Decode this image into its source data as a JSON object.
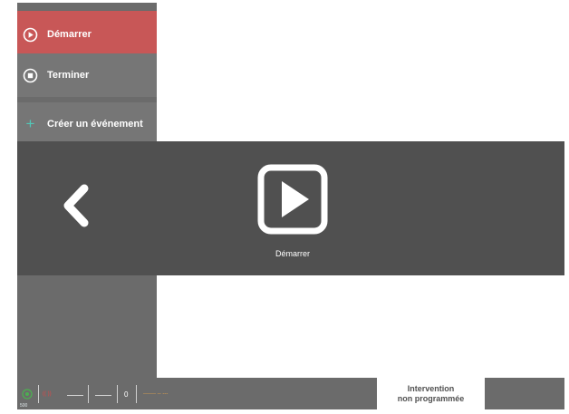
{
  "sidebar": {
    "start_label": "Démarrer",
    "end_label": "Terminer",
    "create_label": "Créer un événement",
    "create_icon_glyph": "+"
  },
  "overlay": {
    "action_label": "Démarrer"
  },
  "footer": {
    "gps_value": "500",
    "red_indicator": "(( ))",
    "counter_value": "0",
    "orange_indicator": "------- -- ---",
    "intervention_line1": "Intervention",
    "intervention_line2": "non programmée"
  },
  "colors": {
    "start_bg": "#c85757",
    "sidebar_bg": "#6b6b6b",
    "overlay_bg": "#505050",
    "accent_teal": "#52c7b8",
    "status_green": "#4caf50",
    "status_red": "#e04545",
    "status_orange": "#e7a54a"
  },
  "icons": {
    "start": "play-circle-icon",
    "end": "stop-circle-icon",
    "create": "plus-icon",
    "back": "chevron-left-icon",
    "big_play": "play-square-icon",
    "gps": "target-icon"
  }
}
